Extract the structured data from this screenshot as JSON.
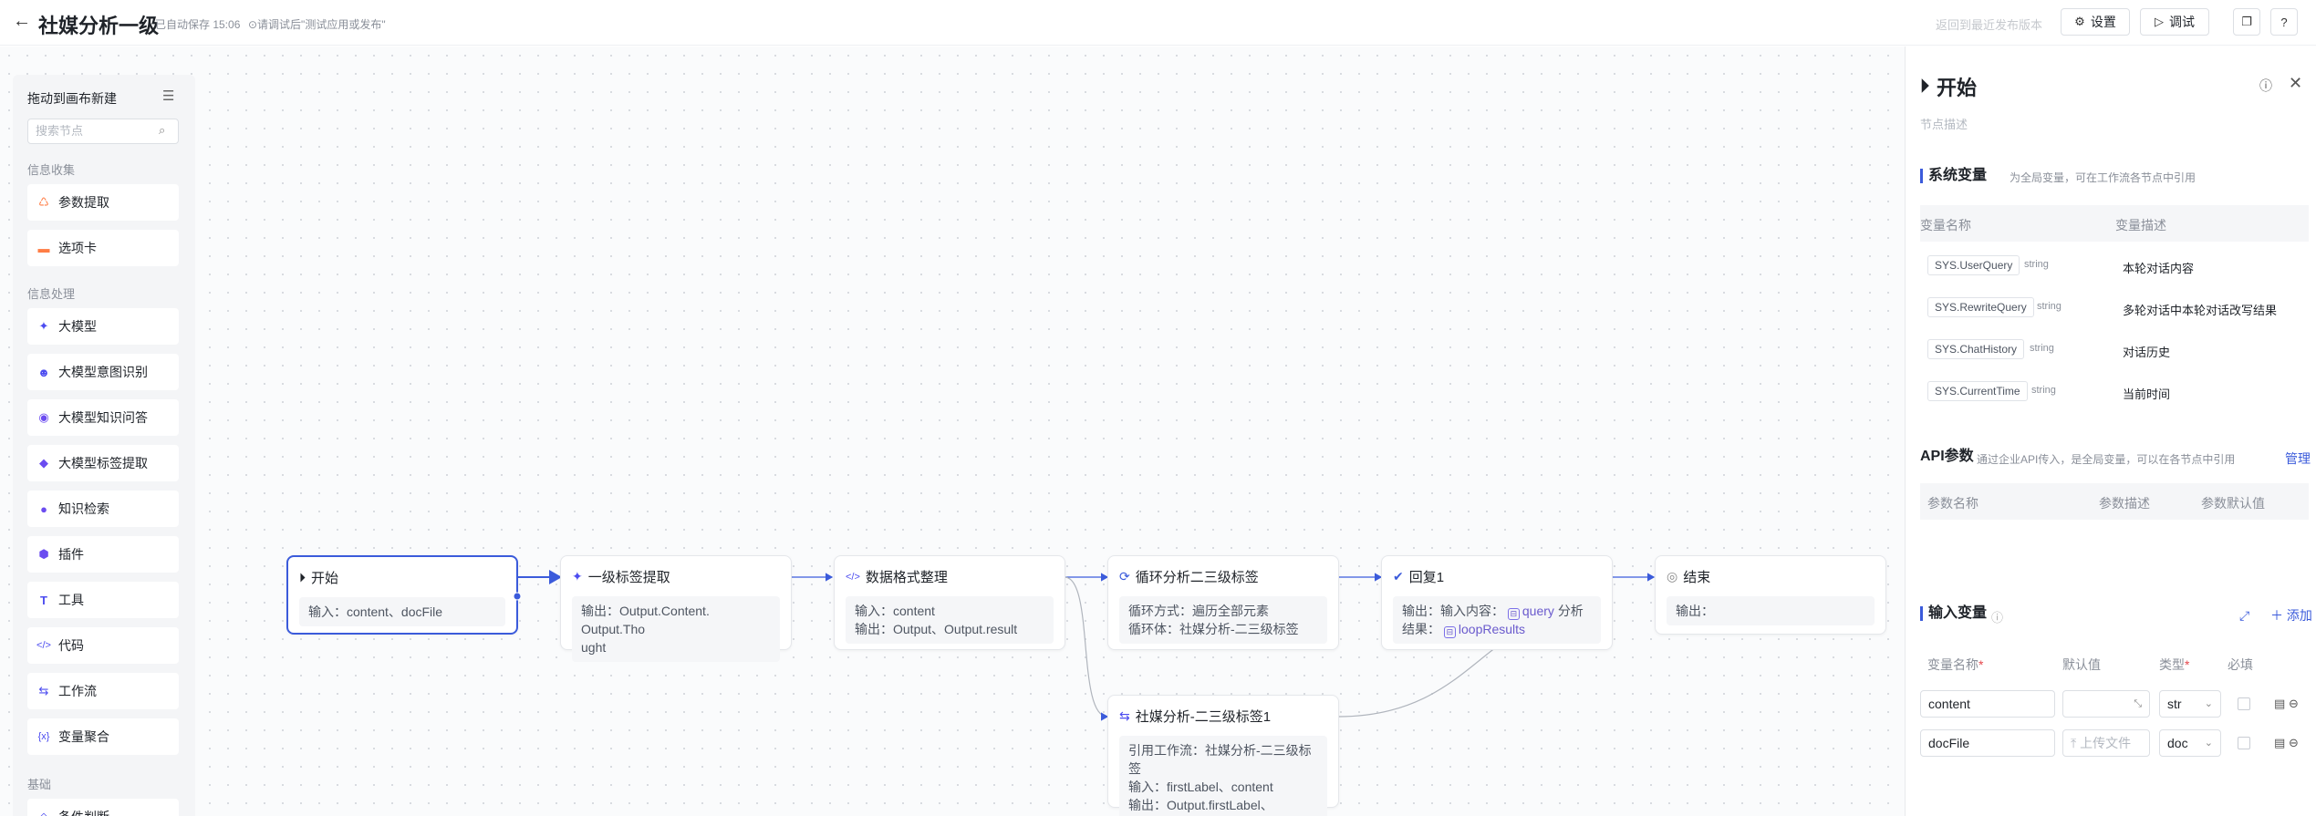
{
  "header": {
    "back_icon": "arrow-left-icon",
    "title": "社媒分析一级",
    "autosave": "已自动保存 15:06",
    "hint": "⊙请调试后\"测试应用或发布\"",
    "revert": "返回到最近发布版本",
    "settings_label": "设置",
    "debug_label": "调试"
  },
  "palette": {
    "title": "拖动到画布新建",
    "search_placeholder": "搜索节点",
    "groups": [
      "信息收集",
      "信息处理",
      "基础"
    ],
    "items": [
      {
        "label": "参数提取",
        "icon": "params-icon",
        "color": "#ff7d45",
        "glyph": "♺"
      },
      {
        "label": "选项卡",
        "icon": "card-icon",
        "color": "#ff7d45",
        "glyph": "▬"
      },
      {
        "label": "大模型",
        "icon": "sparkle-icon",
        "color": "#4c4cf0",
        "glyph": "✦"
      },
      {
        "label": "大模型意图识别",
        "icon": "robot-icon",
        "color": "#4c4cf0",
        "glyph": "☻"
      },
      {
        "label": "大模型知识问答",
        "icon": "knowledge-icon",
        "color": "#6b4cf0",
        "glyph": "◉"
      },
      {
        "label": "大模型标签提取",
        "icon": "tag-icon",
        "color": "#6b4cf0",
        "glyph": "◆"
      },
      {
        "label": "知识检索",
        "icon": "search-icon",
        "color": "#6b4cf0",
        "glyph": "●"
      },
      {
        "label": "插件",
        "icon": "plugin-icon",
        "color": "#6b4cf0",
        "glyph": "⬢"
      },
      {
        "label": "工具",
        "icon": "tool-icon",
        "color": "#4c4cf0",
        "glyph": "T"
      },
      {
        "label": "代码",
        "icon": "code-icon",
        "color": "#4c4cf0",
        "glyph": "</>"
      },
      {
        "label": "工作流",
        "icon": "workflow-icon",
        "color": "#4c4cf0",
        "glyph": "⇆"
      },
      {
        "label": "变量聚合",
        "icon": "variable-icon",
        "color": "#4c4cf0",
        "glyph": "{x}"
      },
      {
        "label": "条件判断",
        "icon": "condition-icon",
        "color": "#4c4cf0",
        "glyph": "◇"
      }
    ]
  },
  "nodes": {
    "start": {
      "title": "开始",
      "icon": "play-icon",
      "lines": [
        "输入：content、docFile"
      ]
    },
    "label1": {
      "title": "一级标签提取",
      "icon": "sparkle-icon",
      "lines": [
        "输出：Output.Content. Output.Tho",
        "ught"
      ]
    },
    "format": {
      "title": "数据格式整理",
      "icon": "code-icon",
      "lines": [
        "输入：content",
        "输出：Output、Output.result"
      ]
    },
    "loop": {
      "title": "循环分析二三级标签",
      "icon": "loop-icon",
      "lines": [
        "循环方式：遍历全部元素",
        "循环体：社媒分析-二三级标签"
      ]
    },
    "reply": {
      "title": "回复1",
      "icon": "check-circle-icon",
      "prefix": "输出：输入内容：",
      "chip1": "query",
      "mid": "分析",
      "line2_prefix": "结果：",
      "chip2": "loopResults"
    },
    "end": {
      "title": "结束",
      "icon": "stop-circle-icon",
      "lines": [
        "输出："
      ]
    },
    "sub": {
      "title": "社媒分析-二三级标签1",
      "icon": "workflow-icon",
      "lines": [
        "引用工作流：社媒分析-二三级标签",
        "输入：firstLabel、content",
        "输出：Output.firstLabel、Output...."
      ]
    }
  },
  "panel": {
    "title": "开始",
    "node_desc_placeholder": "节点描述",
    "sys": {
      "title": "系统变量",
      "subtitle": "为全局变量，可在工作流各节点中引用",
      "col_name": "变量名称",
      "col_desc": "变量描述",
      "rows": [
        {
          "name": "SYS.UserQuery",
          "type": "string",
          "desc": "本轮对话内容"
        },
        {
          "name": "SYS.RewriteQuery",
          "type": "string",
          "desc": "多轮对话中本轮对话改写结果"
        },
        {
          "name": "SYS.ChatHistory",
          "type": "string",
          "desc": "对话历史"
        },
        {
          "name": "SYS.CurrentTime",
          "type": "string",
          "desc": "当前时间"
        }
      ]
    },
    "api": {
      "title": "API参数",
      "subtitle": "通过企业API传入，是全局变量，可以在各节点中引用",
      "manage": "管理",
      "col_name": "参数名称",
      "col_desc": "参数描述",
      "col_default": "参数默认值"
    },
    "input": {
      "title": "输入变量",
      "add": "添加",
      "col_name": "变量名称",
      "col_default": "默认值",
      "col_type": "类型",
      "col_required": "必填",
      "rows": [
        {
          "name": "content",
          "default": "",
          "type": "str"
        },
        {
          "name": "docFile",
          "default": "上传文件",
          "type": "doc"
        }
      ]
    }
  }
}
